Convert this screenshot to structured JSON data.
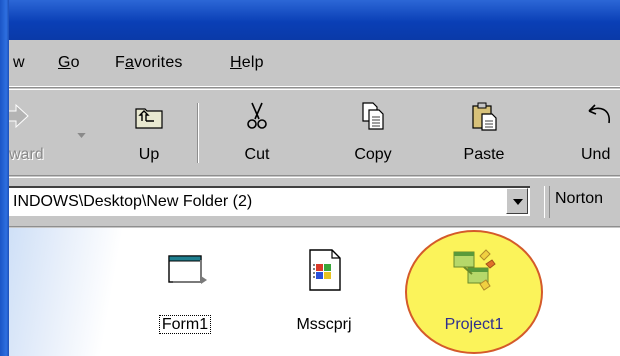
{
  "menubar": {
    "items": [
      {
        "label": "w",
        "underline": ""
      },
      {
        "label": "Go",
        "underline": "G"
      },
      {
        "label": "Favorites",
        "underline": "a"
      },
      {
        "label": "Help",
        "underline": "H"
      }
    ]
  },
  "toolbar": {
    "forward_label": "ward",
    "up_label": "Up",
    "cut_label": "Cut",
    "copy_label": "Copy",
    "paste_label": "Paste",
    "undo_label": "Und"
  },
  "address": {
    "value": "INDOWS\\Desktop\\New Folder (2)",
    "links_label": "Norton"
  },
  "files": [
    {
      "name": "Form1",
      "icon": "form-file-icon",
      "focused": true
    },
    {
      "name": "Msscprj",
      "icon": "ms-document-icon",
      "focused": false
    },
    {
      "name": "Project1",
      "icon": "project-file-icon",
      "focused": false,
      "highlighted": true
    }
  ],
  "colors": {
    "titlebar": "#0a3fb6",
    "chrome": "#c6c6c6",
    "highlight_fill": "#fbf35a",
    "highlight_stroke": "#d45a2a"
  }
}
